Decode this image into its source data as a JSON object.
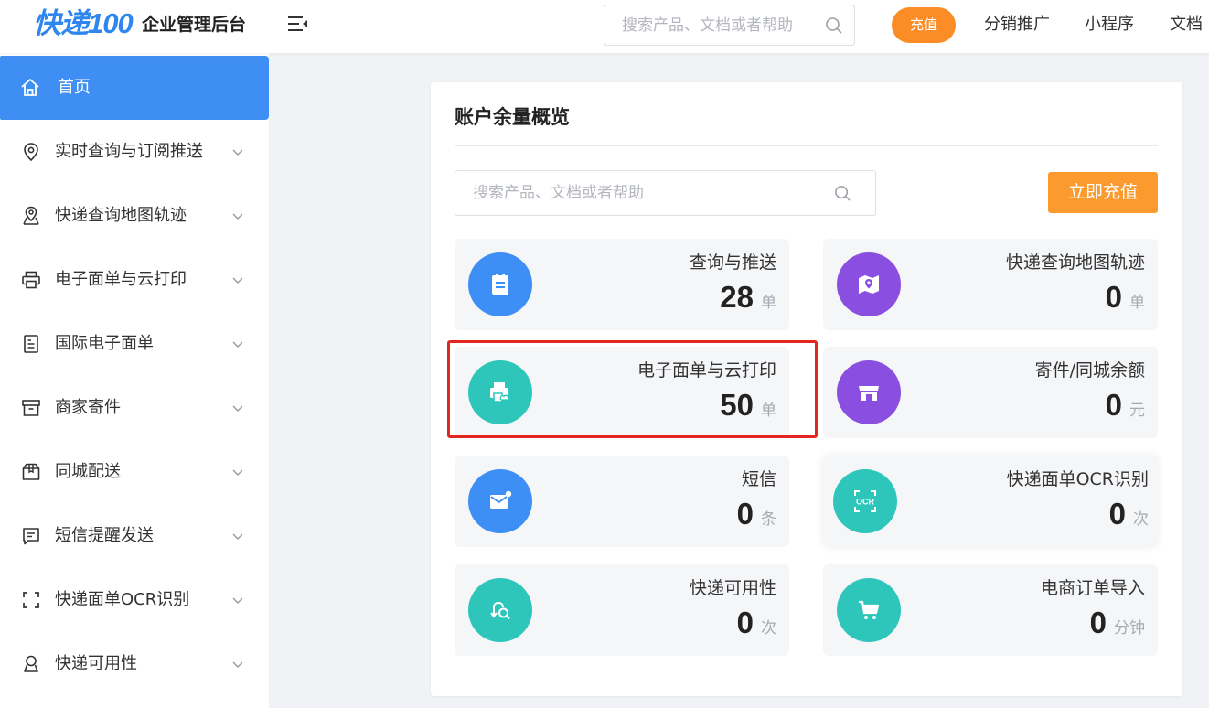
{
  "header": {
    "logo_text": "快递100",
    "title": "企业管理后台",
    "search_placeholder": "搜索产品、文档或者帮助",
    "recharge_label": "充值",
    "nav": [
      "分销推广",
      "小程序",
      "文档"
    ]
  },
  "sidebar": {
    "home_label": "首页",
    "items": [
      {
        "label": "实时查询与订阅推送",
        "icon": "location-pin-icon"
      },
      {
        "label": "快递查询地图轨迹",
        "icon": "map-route-icon"
      },
      {
        "label": "电子面单与云打印",
        "icon": "printer-icon"
      },
      {
        "label": "国际电子面单",
        "icon": "document-icon"
      },
      {
        "label": "商家寄件",
        "icon": "archive-box-icon"
      },
      {
        "label": "同城配送",
        "icon": "package-icon"
      },
      {
        "label": "短信提醒发送",
        "icon": "message-icon"
      },
      {
        "label": "快递面单OCR识别",
        "icon": "scan-icon"
      },
      {
        "label": "快递可用性",
        "icon": "user-location-icon"
      }
    ]
  },
  "main": {
    "title": "账户余量概览",
    "search_placeholder": "搜索产品、文档或者帮助",
    "charge_button": "立即充值",
    "tiles": [
      {
        "name": "查询与推送",
        "value": "28",
        "unit": "单",
        "color": "#3d8ef5",
        "icon": "clipboard-icon"
      },
      {
        "name": "快递查询地图轨迹",
        "value": "0",
        "unit": "单",
        "color": "#8a4fe0",
        "icon": "map-icon"
      },
      {
        "name": "电子面单与云打印",
        "value": "50",
        "unit": "单",
        "color": "#2ec6bb",
        "icon": "cloud-print-icon"
      },
      {
        "name": "寄件/同城余额",
        "value": "0",
        "unit": "元",
        "color": "#8a4fe0",
        "icon": "shop-icon"
      },
      {
        "name": "短信",
        "value": "0",
        "unit": "条",
        "color": "#3d8ef5",
        "icon": "mail-icon"
      },
      {
        "name": "快递面单OCR识别",
        "value": "0",
        "unit": "次",
        "color": "#2ec6bb",
        "icon": "ocr-icon",
        "ocr_text": "OCR"
      },
      {
        "name": "快递可用性",
        "value": "0",
        "unit": "次",
        "color": "#2ec6bb",
        "icon": "route-search-icon"
      },
      {
        "name": "电商订单导入",
        "value": "0",
        "unit": "分钟",
        "color": "#2ec6bb",
        "icon": "cart-icon"
      }
    ]
  },
  "colors": {
    "primary": "#3f8ef3",
    "orange": "#fb9a2e",
    "highlight_red": "#e3271f"
  }
}
